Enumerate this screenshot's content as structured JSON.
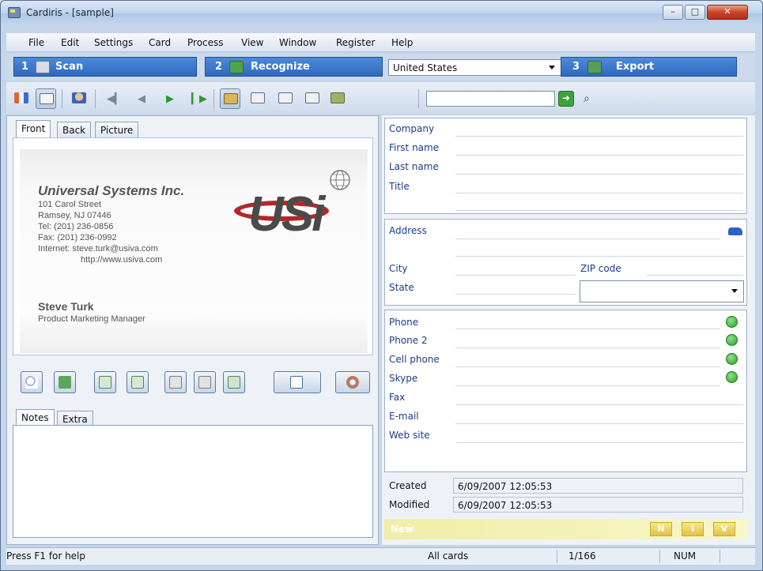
{
  "window": {
    "title": "Cardiris - [sample]"
  },
  "menu": [
    "File",
    "Edit",
    "Settings",
    "Card",
    "Process",
    "View",
    "Window",
    "Register",
    "Help"
  ],
  "steps": [
    {
      "num": "1",
      "label": "Scan"
    },
    {
      "num": "2",
      "label": "Recognize"
    },
    {
      "num": "3",
      "label": "Export"
    }
  ],
  "country": {
    "value": "United States"
  },
  "search": {
    "value": ""
  },
  "card_tabs": [
    "Front",
    "Back",
    "Picture"
  ],
  "card": {
    "company": "Universal Systems Inc.",
    "lines": [
      "101 Carol Street",
      "Ramsey, NJ 07446",
      "Tel: (201) 236-0856",
      "Fax: (201) 236-0992",
      "Internet: steve.turk@usiva.com",
      "http://www.usiva.com"
    ],
    "name": "Steve Turk",
    "job": "Product Marketing Manager",
    "logo": "USi"
  },
  "notes_tabs": [
    "Notes",
    "Extra"
  ],
  "fields": {
    "company": "Company",
    "first_name": "First name",
    "last_name": "Last name",
    "title": "Title",
    "address": "Address",
    "city": "City",
    "zip": "ZIP code",
    "state": "State",
    "phone": "Phone",
    "phone2": "Phone 2",
    "cell": "Cell phone",
    "skype": "Skype",
    "fax": "Fax",
    "email": "E-mail",
    "web": "Web site"
  },
  "meta": {
    "created_label": "Created",
    "created_value": "6/09/2007 12:05:53",
    "modified_label": "Modified",
    "modified_value": "6/09/2007 12:05:53"
  },
  "newbar": {
    "label": "New",
    "buttons": [
      "N",
      "I",
      "V"
    ]
  },
  "status": {
    "help": "Press F1 for help",
    "filter": "All cards",
    "count": "1/166",
    "num": "NUM"
  }
}
